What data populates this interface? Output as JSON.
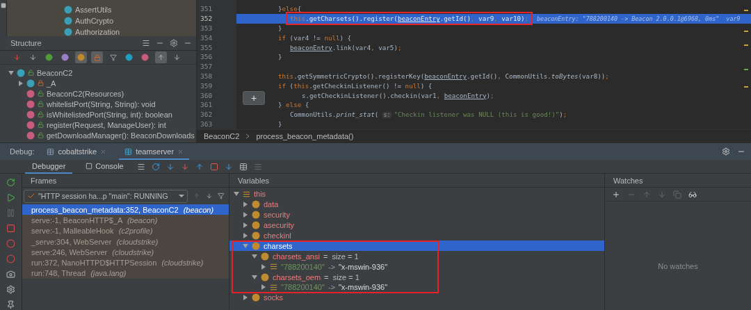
{
  "project_tree": {
    "items": [
      {
        "name": "AssertUtils"
      },
      {
        "name": "AuthCrypto"
      },
      {
        "name": "Authorization"
      }
    ]
  },
  "structure": {
    "title": "Structure",
    "tree": [
      {
        "name": "BeaconC2",
        "kind": "class",
        "private": false,
        "expanded": true,
        "children": [
          {
            "name": "_A",
            "kind": "class",
            "private": true,
            "expanded": false
          },
          {
            "name": "BeaconC2(Resources)",
            "kind": "method",
            "private": false
          },
          {
            "name": "whitelistPort(String, String): void",
            "kind": "method",
            "private": false
          },
          {
            "name": "isWhitelistedPort(String, int): boolean",
            "kind": "method",
            "private": false
          },
          {
            "name": "register(Request, ManageUser): int",
            "kind": "method",
            "private": false
          },
          {
            "name": "getDownloadManager(): BeaconDownloads",
            "kind": "method",
            "private": false
          }
        ]
      }
    ]
  },
  "editor": {
    "lines": [
      {
        "n": "351",
        "kind": "top",
        "current": false,
        "annotated": false,
        "tokens": [
          {
            "kind": "plain",
            "text": "}"
          },
          {
            "kind": "kw",
            "text": "else"
          },
          {
            "kind": "plain",
            "text": "{"
          }
        ]
      },
      {
        "n": "352",
        "kind": "nested",
        "current": true,
        "annotated": true,
        "tokens": [
          {
            "kind": "kw",
            "text": "this"
          },
          {
            "kind": "plain",
            "text": ".getCharsets().register("
          },
          {
            "kind": "ul",
            "text": "beaconEntry"
          },
          {
            "kind": "plain",
            "text": ".getId()"
          },
          {
            "kind": "kw",
            "text": ", "
          },
          {
            "kind": "plain",
            "text": "var9"
          },
          {
            "kind": "kw",
            "text": ", "
          },
          {
            "kind": "plain",
            "text": "var10)"
          },
          {
            "kind": "kw",
            "text": ";"
          }
        ],
        "hint": "beaconEntry: \"788200140 -> Beacon 2.0.0.1@6968, 0ms\"  var9"
      },
      {
        "n": "353",
        "kind": "top",
        "current": false,
        "annotated": false,
        "tokens": [
          {
            "kind": "plain",
            "text": "}"
          }
        ]
      },
      {
        "n": "354",
        "kind": "top",
        "current": false,
        "annotated": false,
        "tokens": [
          {
            "kind": "kw",
            "text": "if"
          },
          {
            "kind": "plain",
            "text": " (var4 != "
          },
          {
            "kind": "kw",
            "text": "null"
          },
          {
            "kind": "plain",
            "text": ") {"
          }
        ]
      },
      {
        "n": "355",
        "kind": "nested",
        "current": false,
        "annotated": false,
        "tokens": [
          {
            "kind": "ul",
            "text": "beaconEntry"
          },
          {
            "kind": "plain",
            "text": ".link(var4"
          },
          {
            "kind": "kw",
            "text": ", "
          },
          {
            "kind": "plain",
            "text": "var5)"
          },
          {
            "kind": "kw",
            "text": ";"
          }
        ]
      },
      {
        "n": "356",
        "kind": "top",
        "current": false,
        "annotated": false,
        "tokens": [
          {
            "kind": "plain",
            "text": "}"
          }
        ]
      },
      {
        "n": "357",
        "kind": "top",
        "current": false,
        "annotated": false
      },
      {
        "n": "358",
        "kind": "top",
        "current": false,
        "annotated": false,
        "tokens": [
          {
            "kind": "kw",
            "text": "this"
          },
          {
            "kind": "plain",
            "text": ".getSymmetricCrypto().registerKey("
          },
          {
            "kind": "ul",
            "text": "beaconEntry"
          },
          {
            "kind": "plain",
            "text": ".getId()"
          },
          {
            "kind": "kw",
            "text": ", "
          },
          {
            "kind": "plain",
            "text": "CommonUtils."
          },
          {
            "kind": "ital",
            "text": "toBytes"
          },
          {
            "kind": "plain",
            "text": "(var8))"
          },
          {
            "kind": "kw",
            "text": ";"
          }
        ]
      },
      {
        "n": "359",
        "kind": "top",
        "current": false,
        "annotated": false,
        "tokens": [
          {
            "kind": "kw",
            "text": "if"
          },
          {
            "kind": "plain",
            "text": " ("
          },
          {
            "kind": "kw",
            "text": "this"
          },
          {
            "kind": "plain",
            "text": ".getCheckinListener() != "
          },
          {
            "kind": "kw",
            "text": "null"
          },
          {
            "kind": "plain",
            "text": ") {"
          }
        ]
      },
      {
        "n": "360",
        "kind": "covered",
        "current": false,
        "annotated": false,
        "tokens": [
          {
            "kind": "plain",
            "text": "s.getCheckinListener().checkin(var1"
          },
          {
            "kind": "kw",
            "text": ", "
          },
          {
            "kind": "ul",
            "text": "beaconEntry"
          },
          {
            "kind": "plain",
            "text": ")"
          },
          {
            "kind": "kw",
            "text": ";"
          }
        ]
      },
      {
        "n": "361",
        "kind": "top",
        "current": false,
        "annotated": false,
        "tokens": [
          {
            "kind": "plain",
            "text": "} "
          },
          {
            "kind": "kw",
            "text": "else"
          },
          {
            "kind": "plain",
            "text": " {"
          }
        ]
      },
      {
        "n": "362",
        "kind": "nested",
        "current": false,
        "annotated": false,
        "tokens": [
          {
            "kind": "plain",
            "text": "CommonUtils."
          },
          {
            "kind": "ital",
            "text": "print_stat"
          },
          {
            "kind": "plain",
            "text": "( "
          },
          {
            "kind": "param",
            "text": "s:"
          },
          {
            "kind": "str",
            "text": "\"Checkin listener was NULL (this is good!)\""
          },
          {
            "kind": "plain",
            "text": ")"
          },
          {
            "kind": "kw",
            "text": ";"
          }
        ]
      },
      {
        "n": "363",
        "kind": "top",
        "current": false,
        "annotated": false,
        "tokens": [
          {
            "kind": "plain",
            "text": "}"
          }
        ]
      }
    ],
    "popup_label": "+",
    "breadcrumbs": [
      "BeaconC2",
      "process_beacon_metadata()"
    ]
  },
  "debug": {
    "label": "Debug:",
    "tabs": [
      {
        "label": "cobaltstrike",
        "selected": false
      },
      {
        "label": "teamserver",
        "selected": true
      }
    ],
    "view_tabs": [
      {
        "label": "Debugger",
        "selected": true
      },
      {
        "label": "Console",
        "selected": false
      }
    ],
    "frames": {
      "title": "Frames",
      "thread": "\"HTTP session ha...p \"main\": RUNNING",
      "items": [
        {
          "method": "process_beacon_metadata:352, BeaconC2",
          "package": "(beacon)",
          "selected": true
        },
        {
          "method": "serve:-1, BeaconHTTP$_A",
          "package": "(beacon)",
          "selected": false
        },
        {
          "method": "serve:-1, MalleableHook",
          "package": "(c2profile)",
          "selected": false
        },
        {
          "method": "_serve:304, WebServer",
          "package": "(cloudstrike)",
          "selected": false
        },
        {
          "method": "serve:246, WebServer",
          "package": "(cloudstrike)",
          "selected": false
        },
        {
          "method": "run:372, NanoHTTPD$HTTPSession",
          "package": "(cloudstrike)",
          "selected": false
        },
        {
          "method": "run:748, Thread",
          "package": "(java.lang)",
          "selected": false
        }
      ]
    },
    "variables": {
      "title": "Variables",
      "items": [
        {
          "name": "this",
          "kind": "object",
          "expanded": true,
          "selected": false,
          "annotated": false,
          "children": [
            {
              "name": "data",
              "kind": "field",
              "expanded": false,
              "selected": false,
              "annotated": false
            },
            {
              "name": "security",
              "kind": "field",
              "expanded": false,
              "selected": false,
              "annotated": false
            },
            {
              "name": "asecurity",
              "kind": "field",
              "expanded": false,
              "selected": false,
              "annotated": false
            },
            {
              "name": "checkinl",
              "kind": "field",
              "expanded": false,
              "selected": false,
              "annotated": false
            },
            {
              "name": "charsets",
              "kind": "field",
              "expanded": true,
              "selected": true,
              "annotated": true,
              "children": [
                {
                  "name": "charsets_ansi",
                  "kind": "field",
                  "value": "=  size = 1",
                  "expanded": true,
                  "selected": false,
                  "annotated": false,
                  "children": [
                    {
                      "kind": "entry",
                      "key": "\"788200140\"",
                      "arrow": "->",
                      "value": "\"x-mswin-936\"",
                      "expanded": false,
                      "selected": false,
                      "annotated": false
                    }
                  ]
                },
                {
                  "name": "charsets_oem",
                  "kind": "field",
                  "value": "=  size = 1",
                  "expanded": true,
                  "selected": false,
                  "annotated": false,
                  "children": [
                    {
                      "kind": "entry",
                      "key": "\"788200140\"",
                      "arrow": "->",
                      "value": "\"x-mswin-936\"",
                      "expanded": false,
                      "selected": false,
                      "annotated": false
                    }
                  ]
                }
              ]
            },
            {
              "name": "socks",
              "kind": "field",
              "expanded": false,
              "selected": false,
              "annotated": false
            }
          ]
        }
      ]
    },
    "watches": {
      "title": "Watches",
      "empty_text": "No watches"
    }
  }
}
